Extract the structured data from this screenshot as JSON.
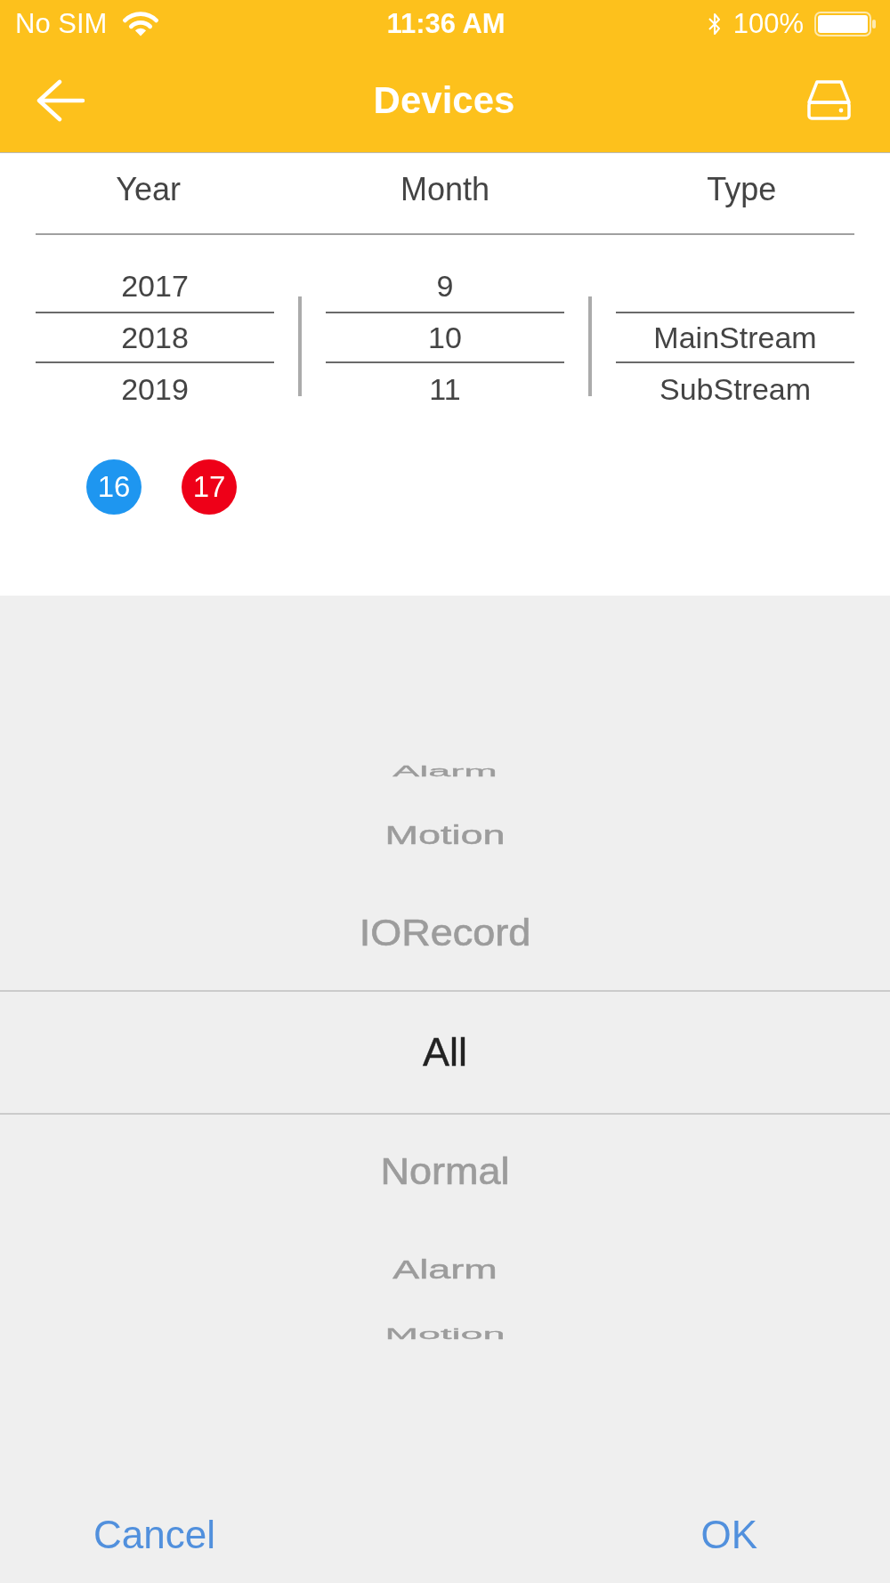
{
  "status_bar": {
    "carrier": "No SIM",
    "time": "11:36 AM",
    "battery": "100%"
  },
  "nav_bar": {
    "title": "Devices"
  },
  "pickers": [
    {
      "heading": "Year",
      "items": [
        {
          "label": "2017",
          "selected": false
        },
        {
          "label": "2018",
          "selected": true
        },
        {
          "label": "2019",
          "selected": false
        }
      ]
    },
    {
      "heading": "Month",
      "items": [
        {
          "label": "9",
          "selected": false
        },
        {
          "label": "10",
          "selected": true
        },
        {
          "label": "11",
          "selected": false
        }
      ]
    },
    {
      "heading": "Type",
      "items": [
        {
          "label": "MainStream",
          "selected": true
        },
        {
          "label": "SubStream",
          "selected": false
        }
      ]
    }
  ],
  "days": [
    {
      "label": "16",
      "color": "#1e96f0"
    },
    {
      "label": "17",
      "color": "#ee0018"
    }
  ],
  "type_wheel": {
    "items": [
      {
        "label": "Alarm",
        "selected": false
      },
      {
        "label": "Motion",
        "selected": false
      },
      {
        "label": "IORecord",
        "selected": false
      },
      {
        "label": "All",
        "selected": true
      },
      {
        "label": "Normal",
        "selected": false
      },
      {
        "label": "Alarm",
        "selected": false
      },
      {
        "label": "Motion",
        "selected": false
      }
    ]
  },
  "dialog_buttons": {
    "cancel": "Cancel",
    "ok": "OK"
  }
}
